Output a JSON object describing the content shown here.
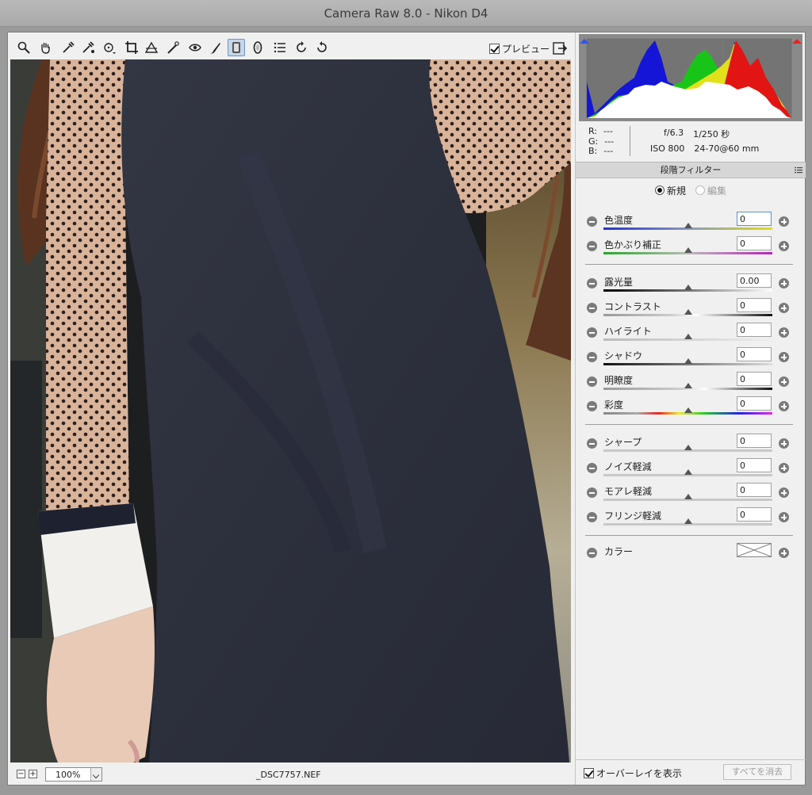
{
  "window": {
    "title": "Camera Raw 8.0  -  Nikon D4"
  },
  "toolbar": {
    "tools": [
      {
        "name": "zoom-tool-icon"
      },
      {
        "name": "hand-tool-icon"
      },
      {
        "name": "white-balance-tool-icon"
      },
      {
        "name": "color-sampler-tool-icon"
      },
      {
        "name": "targeted-adjustment-tool-icon"
      },
      {
        "name": "crop-tool-icon"
      },
      {
        "name": "straighten-tool-icon"
      },
      {
        "name": "spot-removal-tool-icon"
      },
      {
        "name": "red-eye-removal-icon"
      },
      {
        "name": "adjustment-brush-icon"
      },
      {
        "name": "graduated-filter-icon",
        "active": true
      },
      {
        "name": "radial-filter-icon"
      },
      {
        "name": "preferences-icon"
      },
      {
        "name": "rotate-ccw-icon"
      },
      {
        "name": "rotate-cw-icon"
      }
    ],
    "preview_label": "プレビュー",
    "preview_checked": true
  },
  "info": {
    "r_label": "R:",
    "g_label": "G:",
    "b_label": "B:",
    "r_value": "---",
    "g_value": "---",
    "b_value": "---",
    "aperture": "f/6.3",
    "shutter": "1/250 秒",
    "iso": "ISO 800",
    "lens": "24-70@60 mm"
  },
  "panel": {
    "title": "段階フィルター",
    "mode_new": "新規",
    "mode_edit": "編集",
    "params": [
      {
        "label": "色温度",
        "value": "0",
        "level": 0.5,
        "track": "temp",
        "focus": true
      },
      {
        "label": "色かぶり補正",
        "value": "0",
        "level": 0.5,
        "track": "tint"
      },
      {
        "label": "露光量",
        "value": "0.00",
        "level": 0.5,
        "track": "exposure"
      },
      {
        "label": "コントラスト",
        "value": "0",
        "level": 0.5,
        "track": "contrast"
      },
      {
        "label": "ハイライト",
        "value": "0",
        "level": 0.5,
        "track": "highlights"
      },
      {
        "label": "シャドウ",
        "value": "0",
        "level": 0.5,
        "track": "shadows"
      },
      {
        "label": "明瞭度",
        "value": "0",
        "level": 0.5,
        "track": "clarity"
      },
      {
        "label": "彩度",
        "value": "0",
        "level": 0.5,
        "track": "saturation"
      },
      {
        "label": "シャープ",
        "value": "0",
        "level": 0.5,
        "track": "plain"
      },
      {
        "label": "ノイズ軽減",
        "value": "0",
        "level": 0.5,
        "track": "plain"
      },
      {
        "label": "モアレ軽減",
        "value": "0",
        "level": 0.5,
        "track": "plain"
      },
      {
        "label": "フリンジ軽減",
        "value": "0",
        "level": 0.5,
        "track": "plain"
      }
    ],
    "color_label": "カラー",
    "overlay_label": "オーバーレイを表示",
    "overlay_checked": true,
    "clear_all": "すべてを消去"
  },
  "status": {
    "zoom": "100%",
    "filename": "_DSC7757.NEF",
    "zoom_out": "−",
    "zoom_in": "+"
  }
}
